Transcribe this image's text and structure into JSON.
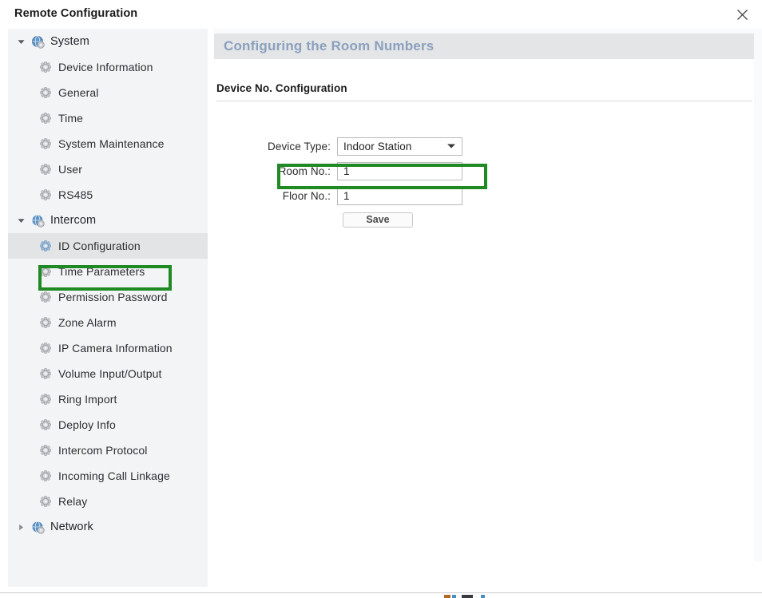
{
  "window": {
    "title": "Remote Configuration",
    "close_icon": "close-icon"
  },
  "colors": {
    "highlight_green": "#1f8a23",
    "panel_header_text": "#8aa0bd",
    "panel_header_bg": "#e4e5e7",
    "sidebar_bg": "#f3f4f6",
    "selected_row_bg": "#e3e4e6"
  },
  "sidebar": {
    "groups": [
      {
        "label": "System",
        "icon": "globe-gear-icon",
        "twisty": "chevron-down-icon",
        "expanded": true,
        "items": [
          {
            "label": "Device Information",
            "icon": "gear-icon",
            "selected": false
          },
          {
            "label": "General",
            "icon": "gear-icon",
            "selected": false
          },
          {
            "label": "Time",
            "icon": "gear-icon",
            "selected": false
          },
          {
            "label": "System Maintenance",
            "icon": "gear-icon",
            "selected": false
          },
          {
            "label": "User",
            "icon": "gear-icon",
            "selected": false
          },
          {
            "label": "RS485",
            "icon": "gear-icon",
            "selected": false
          }
        ]
      },
      {
        "label": "Intercom",
        "icon": "globe-gear-icon",
        "twisty": "chevron-down-icon",
        "expanded": true,
        "items": [
          {
            "label": "ID Configuration",
            "icon": "gear-icon",
            "selected": true
          },
          {
            "label": "Time Parameters",
            "icon": "gear-icon",
            "selected": false
          },
          {
            "label": "Permission Password",
            "icon": "gear-icon",
            "selected": false
          },
          {
            "label": "Zone Alarm",
            "icon": "gear-icon",
            "selected": false
          },
          {
            "label": "IP Camera Information",
            "icon": "gear-icon",
            "selected": false
          },
          {
            "label": "Volume Input/Output",
            "icon": "gear-icon",
            "selected": false
          },
          {
            "label": "Ring Import",
            "icon": "gear-icon",
            "selected": false
          },
          {
            "label": "Deploy Info",
            "icon": "gear-icon",
            "selected": false
          },
          {
            "label": "Intercom Protocol",
            "icon": "gear-icon",
            "selected": false
          },
          {
            "label": "Incoming Call Linkage",
            "icon": "gear-icon",
            "selected": false
          },
          {
            "label": "Relay",
            "icon": "gear-icon",
            "selected": false
          }
        ]
      },
      {
        "label": "Network",
        "icon": "globe-gear-icon",
        "twisty": "chevron-right-icon",
        "expanded": false,
        "items": []
      }
    ]
  },
  "panel": {
    "header_title": "Configuring the Room Numbers",
    "section_title": "Device No. Configuration",
    "fields": {
      "device_type": {
        "label": "Device Type:",
        "value": "Indoor Station",
        "options": [
          "Indoor Station"
        ],
        "arrow_icon": "chevron-down-icon"
      },
      "room_no": {
        "label": "Room No.:",
        "value": "1",
        "placeholder": ""
      },
      "floor_no": {
        "label": "Floor No.:",
        "value": "1",
        "placeholder": ""
      }
    },
    "save_label": "Save"
  }
}
